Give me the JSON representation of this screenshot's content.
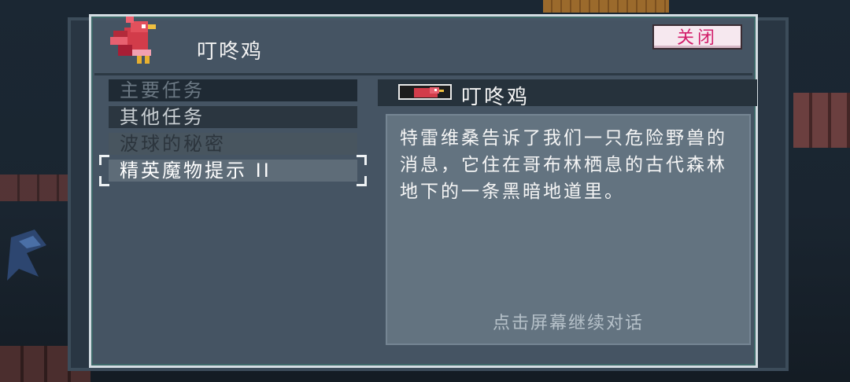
{
  "dialog": {
    "speaker_name": "叮咚鸡",
    "close_label": "关闭"
  },
  "quests": [
    {
      "label": "主要任务"
    },
    {
      "label": "其他任务"
    },
    {
      "label": "波球的秘密"
    },
    {
      "label": "精英魔物提示 II"
    }
  ],
  "detail": {
    "title": "叮咚鸡",
    "text": "特雷维桑告诉了我们一只危险野兽的消息，它住在哥布林栖息的古代森林地下的一条黑暗地道里。",
    "continue_hint": "点击屏幕继续对话"
  },
  "colors": {
    "close_text": "#d21e6a",
    "accent_teal": "#3e6a6a"
  }
}
